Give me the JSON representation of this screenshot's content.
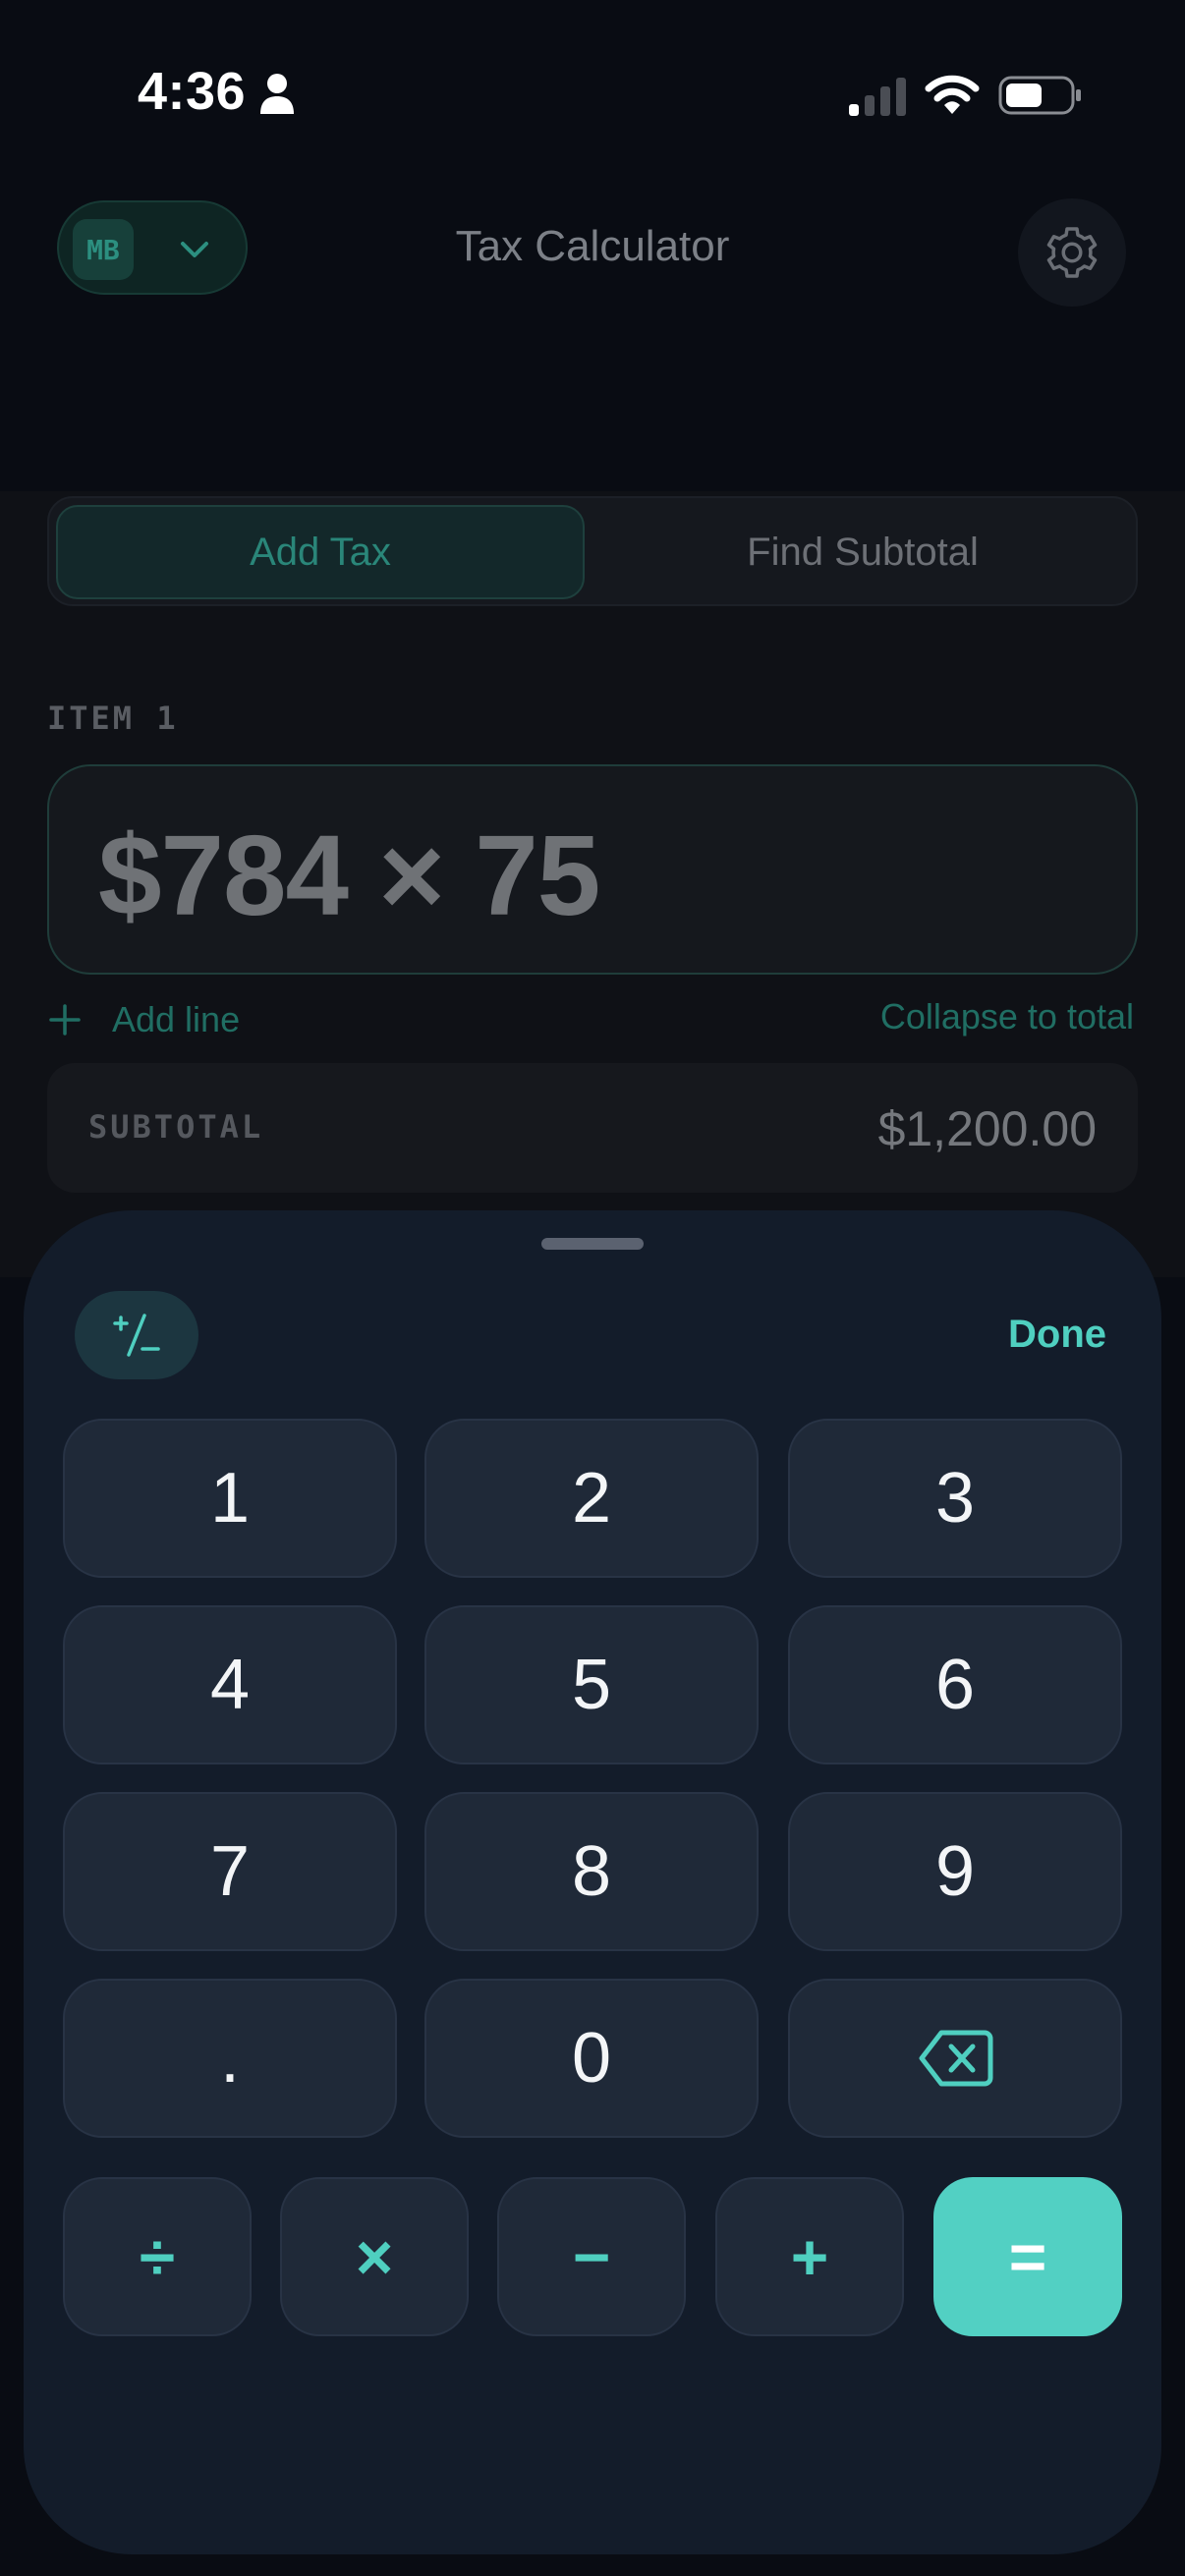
{
  "status_bar": {
    "time": "4:36"
  },
  "header": {
    "profile_initials": "MB",
    "title": "Tax Calculator"
  },
  "mode_tabs": [
    {
      "label": "Add Tax",
      "active": true
    },
    {
      "label": "Find Subtotal",
      "active": false
    }
  ],
  "item": {
    "label": "ITEM 1",
    "expression": "$784 × 75"
  },
  "actions": {
    "add_line": "Add line",
    "collapse": "Collapse to total"
  },
  "subtotal": {
    "label": "SUBTOTAL",
    "value": "$1,200.00"
  },
  "keypad": {
    "sign_toggle": "+/−",
    "done_label": "Done",
    "digit_keys": [
      "1",
      "2",
      "3",
      "4",
      "5",
      "6",
      "7",
      "8",
      "9",
      ".",
      "0"
    ],
    "backspace_icon": "backspace-icon",
    "operator_keys": [
      "÷",
      "×",
      "−",
      "+"
    ],
    "equals": "="
  },
  "colors": {
    "accent": "#4fcfc0",
    "sheet_background": "#131c2a",
    "key_background": "#1f2938",
    "page_background": "#090c13"
  }
}
